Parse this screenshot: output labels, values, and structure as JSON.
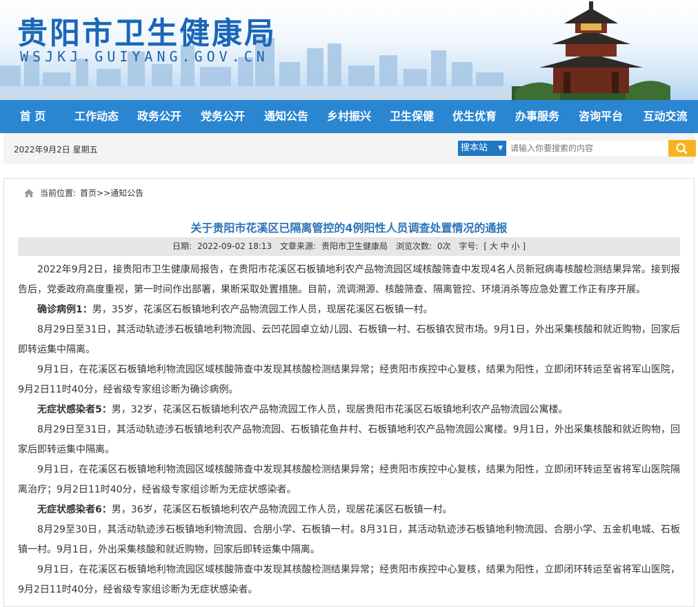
{
  "header": {
    "site_title": "贵阳市卫生健康局",
    "site_domain": "WSJKJ.GUIYANG.GOV.CN"
  },
  "nav": {
    "items": [
      "首 页",
      "工作动态",
      "政务公开",
      "党务公开",
      "通知公告",
      "乡村振兴",
      "卫生保健",
      "优生优育",
      "办事服务",
      "咨询平台",
      "互动交流"
    ]
  },
  "infobar": {
    "date": "2022年9月2日 星期五",
    "search_select": "搜本站",
    "search_placeholder": "请输入你要搜索的内容"
  },
  "breadcrumb": {
    "label": "当前位置:",
    "path": "首页>>通知公告"
  },
  "article": {
    "title": "关于贵阳市花溪区已隔离管控的4例阳性人员调查处置情况的通报",
    "meta": {
      "date_label": "日期:",
      "date": "2022-09-02 18:13",
      "source_label": "文章来源:",
      "source": "贵阳市卫生健康局",
      "views_label": "浏览次数:",
      "views": "0次",
      "fontsize_label": "字号:",
      "fontsize_options": "[ 大 中 小 ]"
    },
    "paragraphs": [
      {
        "lead": "",
        "text": "2022年9月2日，接贵阳市卫生健康局报告，在贵阳市花溪区石板镇地利农产品物流园区域核酸筛查中发现4名人员新冠病毒核酸检测结果异常。接到报告后，党委政府高度重视，第一时间作出部署，果断采取处置措施。目前，流调溯源、核酸筛查、隔离管控、环境消杀等应急处置工作正有序开展。"
      },
      {
        "lead": "确诊病例1：",
        "text": "男，35岁，花溪区石板镇地利农产品物流园工作人员，现居花溪区石板镇一村。"
      },
      {
        "lead": "",
        "text": "8月29日至31日，其活动轨迹涉石板镇地利物流园、云凹花园卓立幼儿园、石板镇一村、石板镇农贸市场。9月1日，外出采集核酸和就近购物，回家后即转运集中隔离。"
      },
      {
        "lead": "",
        "text": "9月1日，在花溪区石板镇地利物流园区域核酸筛查中发现其核酸检测结果异常；经贵阳市疾控中心复核，结果为阳性，立即闭环转运至省将军山医院，9月2日11时40分，经省级专家组诊断为确诊病例。"
      },
      {
        "lead": "无症状感染者5：",
        "text": "男，32岁，花溪区石板镇地利农产品物流园工作人员，现居贵阳市花溪区石坂镇地利农产品物流园公寓楼。"
      },
      {
        "lead": "",
        "text": "8月29日至31日，其活动轨迹涉石板镇地利农产品物流园、石板镇花鱼井村、石板镇地利农产品物流园公寓楼。9月1日，外出采集核酸和就近购物，回家后即转运集中隔离。"
      },
      {
        "lead": "",
        "text": "9月1日，在花溪区石板镇地利物流园区域核酸筛查中发现其核酸检测结果异常；经贵阳市疾控中心复核，结果为阳性，立即闭环转运至省将军山医院隔离治疗；9月2日11时40分，经省级专家组诊断为无症状感染者。"
      },
      {
        "lead": "无症状感染者6：",
        "text": "男，36岁，花溪区石板镇地利农产品物流园工作人员，现居花溪区石板镇一村。"
      },
      {
        "lead": "",
        "text": "8月29至30日，其活动轨迹涉石板镇地利物流园、合朋小学、石板镇一村。8月31日，其活动轨迹涉石板镇地利物流园、合朋小学、五金机电城、石板镇一村。9月1日，外出采集核酸和就近购物，回家后即转运集中隔离。"
      },
      {
        "lead": "",
        "text": "9月1日，在花溪区石板镇地利物流园区域核酸筛查中发现其核酸检测结果异常；经贵阳市疾控中心复核，结果为阳性，立即闭环转运至省将军山医院，9月2日11时40分，经省级专家组诊断为无症状感染者。"
      }
    ]
  }
}
